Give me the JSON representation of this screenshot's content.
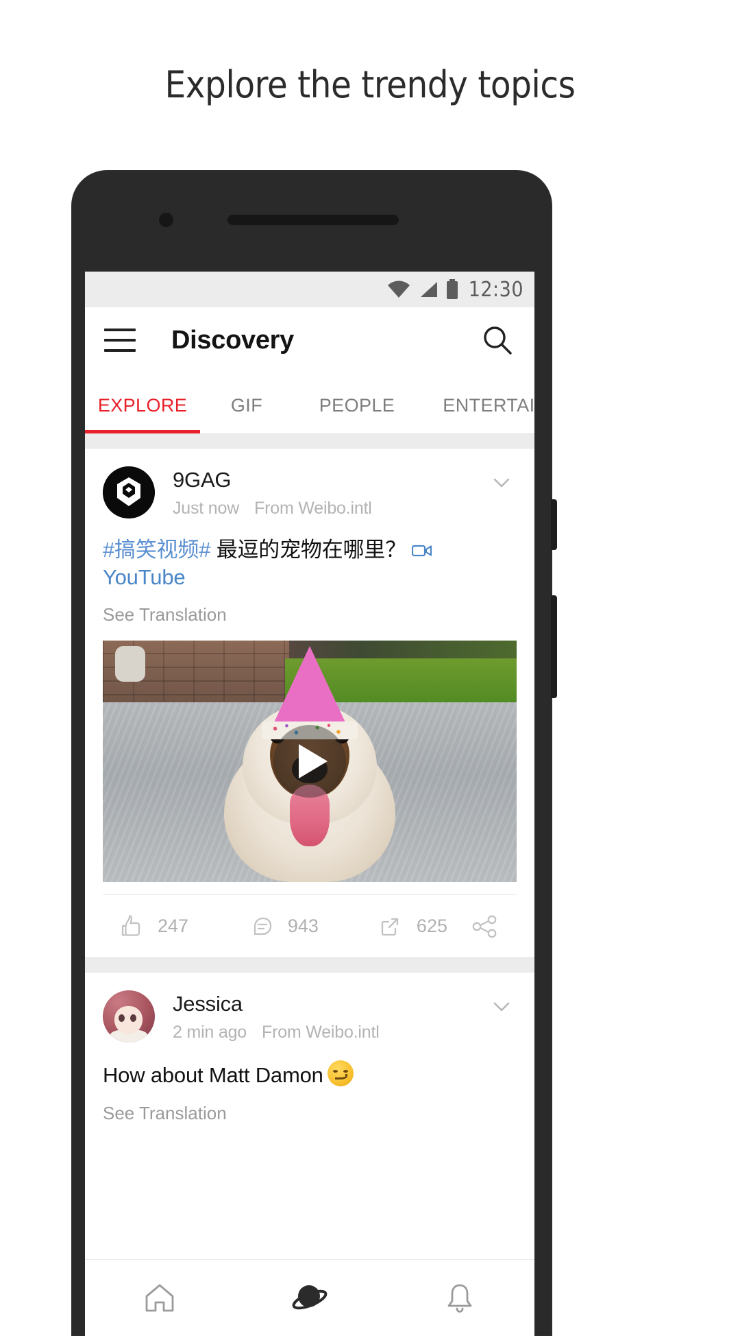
{
  "promo": {
    "headline": "Explore the trendy topics"
  },
  "status_bar": {
    "time": "12:30",
    "icons": [
      "wifi-icon",
      "signal-icon",
      "battery-icon"
    ]
  },
  "app_bar": {
    "menu_icon": "hamburger-menu-icon",
    "title": "Discovery",
    "search_icon": "search-icon"
  },
  "tabs": [
    {
      "label": "EXPLORE",
      "active": true
    },
    {
      "label": "GIF",
      "active": false
    },
    {
      "label": "PEOPLE",
      "active": false
    },
    {
      "label": "ENTERTAINME",
      "active": false
    }
  ],
  "colors": {
    "accent_red": "#e8202a",
    "link_blue": "#4a86c8",
    "hashtag_blue": "#5a8fd0",
    "muted_gray": "#b3b3b3"
  },
  "feed": [
    {
      "author": "9GAG",
      "time": "Just now",
      "source": "From Weibo.intl",
      "hashtag": "#搞笑视频#",
      "body": "最逗的宠物在哪里？",
      "link_label": "YouTube",
      "link_icon": "video-camera-icon",
      "translation_label": "See Translation",
      "media_type": "video",
      "play_icon": "play-icon",
      "actions": [
        {
          "icon": "thumbs-up-icon",
          "count": "247"
        },
        {
          "icon": "comment-icon",
          "count": "943"
        },
        {
          "icon": "repost-icon",
          "count": "625"
        },
        {
          "icon": "share-icon",
          "count": ""
        }
      ]
    },
    {
      "author": "Jessica",
      "time": "2 min ago",
      "source": "From Weibo.intl",
      "body": "How about Matt Damon",
      "emoji": "smirking-face-emoji",
      "translation_label": "See Translation"
    }
  ],
  "bottom_nav": [
    {
      "icon": "home-icon",
      "active": false
    },
    {
      "icon": "discover-planet-icon",
      "active": true
    },
    {
      "icon": "notifications-bell-icon",
      "active": false
    }
  ]
}
